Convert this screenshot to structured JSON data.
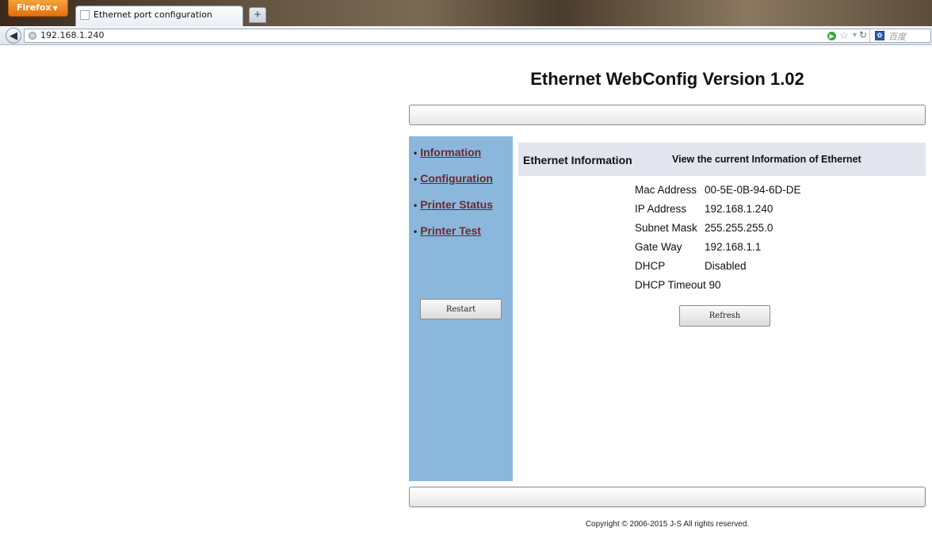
{
  "browser": {
    "app_button": "Firefox",
    "tab_title": "Ethernet port configuration",
    "new_tab": "+",
    "url": "192.168.1.240",
    "search_placeholder": "百度"
  },
  "page": {
    "title": "Ethernet WebConfig Version 1.02",
    "copyright": "Copyright © 2006-2015 J-S All rights reserved."
  },
  "sidebar": {
    "items": [
      {
        "label": "Information"
      },
      {
        "label": "Configuration"
      },
      {
        "label": "Printer Status"
      },
      {
        "label": "Printer Test"
      }
    ],
    "restart_label": "Restart"
  },
  "content": {
    "header_title": "Ethernet Information",
    "header_desc": "View the current Information of Ethernet",
    "rows": [
      {
        "label": "Mac Address",
        "value": "00-5E-0B-94-6D-DE"
      },
      {
        "label": "IP Address",
        "value": "192.168.1.240"
      },
      {
        "label": "Subnet Mask",
        "value": "255.255.255.0"
      },
      {
        "label": "Gate Way",
        "value": "192.168.1.1"
      },
      {
        "label": "DHCP",
        "value": "Disabled"
      },
      {
        "label": "DHCP Timeout",
        "value": "90"
      }
    ],
    "refresh_label": "Refresh"
  },
  "icons": {
    "back": "back-arrow-icon",
    "site": "globe-icon",
    "go": "go-icon",
    "bookmark": "star-icon",
    "reload": "reload-icon",
    "search_engine": "baidu-icon"
  },
  "colors": {
    "sidebar_bg": "#8cb7dd",
    "link": "#6b2a2a",
    "header_bg": "#e2e4ee",
    "firefox_orange": "#e3700d"
  }
}
